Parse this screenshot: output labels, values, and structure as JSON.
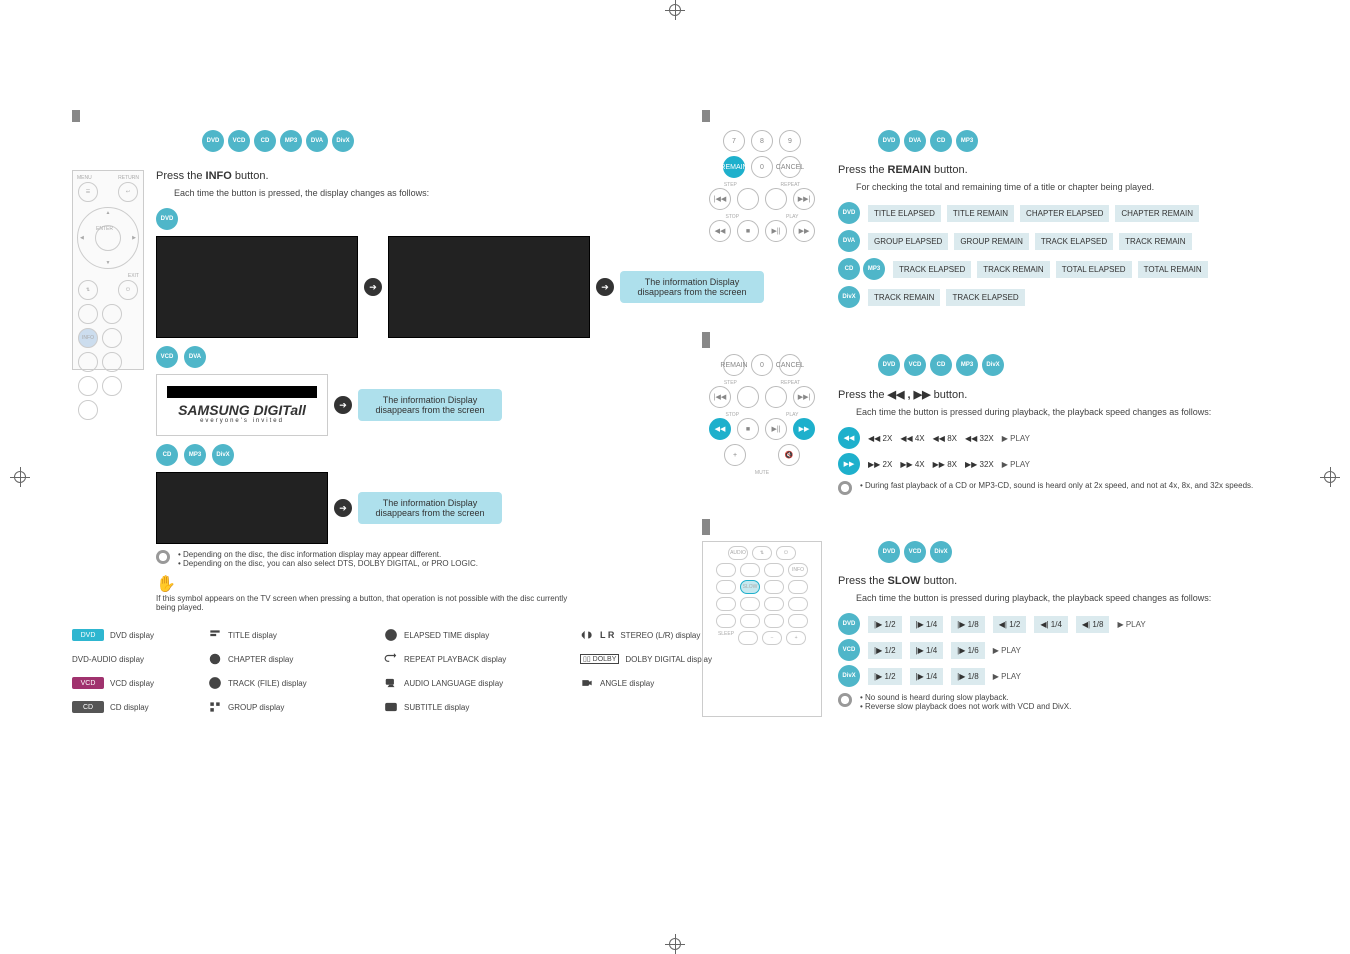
{
  "left": {
    "disc_row_count": 6,
    "press_info": "Press the",
    "button_word": "button.",
    "press_sub": "Each time the button is pressed, the display changes as follows:",
    "info_box": "The information Display disappears from the screen",
    "notes": [
      "• Depending on the disc, the disc information display may appear different.",
      "• Depending on the disc, you can also select DTS, DOLBY DIGITAL, or PRO LOGIC."
    ],
    "hand_text": "If this symbol appears on the TV screen when pressing a button, that operation is not possible with the disc currently being played.",
    "logo_main": "SAMSUNG DIGITall",
    "logo_sub": "everyone's invited",
    "legend": {
      "col1": [
        {
          "badge": "DVD",
          "cls": "b-dvd",
          "label": "DVD display"
        },
        {
          "badge": "",
          "cls": "",
          "label": "DVD-AUDIO display"
        },
        {
          "badge": "VCD",
          "cls": "b-vcd",
          "label": "VCD display"
        },
        {
          "badge": "CD",
          "cls": "b-cd",
          "label": "CD display"
        }
      ],
      "col2": [
        {
          "icon": "title",
          "label": "TITLE display"
        },
        {
          "icon": "chapter",
          "label": "CHAPTER display"
        },
        {
          "icon": "track",
          "label": "TRACK (FILE) display"
        },
        {
          "icon": "group",
          "label": "GROUP display"
        }
      ],
      "col3": [
        {
          "icon": "clock",
          "label": "ELAPSED TIME display"
        },
        {
          "icon": "repeat",
          "label": "REPEAT PLAYBACK display"
        },
        {
          "icon": "audio",
          "label": "AUDIO LANGUAGE display"
        },
        {
          "icon": "subtitle",
          "label": "SUBTITLE display"
        }
      ],
      "col4": [
        {
          "icon": "stereo",
          "label": "STEREO (L/R) display",
          "pre": "L R"
        },
        {
          "icon": "dolby",
          "label": "DOLBY DIGITAL display"
        },
        {
          "icon": "angle",
          "label": "ANGLE display"
        }
      ]
    },
    "remote": {
      "menu": "MENU",
      "return": "RETURN",
      "enter": "ENTER",
      "exit": "EXIT"
    }
  },
  "right": {
    "s1": {
      "discs": 4,
      "press": "Press the",
      "button": "button.",
      "sub": "For checking the total and remaining time of a title or chapter being played.",
      "rows": [
        {
          "badges": 1,
          "chips": [
            "TITLE ELAPSED",
            "TITLE REMAIN",
            "CHAPTER ELAPSED",
            "CHAPTER REMAIN"
          ]
        },
        {
          "badges": 1,
          "chips": [
            "GROUP ELAPSED",
            "GROUP REMAIN",
            "TRACK ELAPSED",
            "TRACK REMAIN"
          ]
        },
        {
          "badges": 2,
          "chips": [
            "TRACK ELAPSED",
            "TRACK REMAIN",
            "TOTAL ELAPSED",
            "TOTAL REMAIN"
          ]
        },
        {
          "badges": 1,
          "chips": [
            "TRACK REMAIN",
            "TRACK ELAPSED"
          ]
        }
      ],
      "keypad": {
        "seven": "7",
        "eight": "8",
        "nine": "9",
        "zero": "0",
        "remain": "REMAIN",
        "cancel": "CANCEL"
      }
    },
    "s2": {
      "discs": 5,
      "press": "Press the",
      "buttonglyph": "◀◀ , ▶▶",
      "button": "button.",
      "sub": "Each time the button is pressed during playback, the playback speed changes as follows:",
      "rows": [
        {
          "dir": "◀◀",
          "vals": [
            "2X",
            "4X",
            "8X",
            "32X"
          ],
          "end": "▶ PLAY"
        },
        {
          "dir": "▶▶",
          "vals": [
            "2X",
            "4X",
            "8X",
            "32X"
          ],
          "end": "▶ PLAY"
        }
      ],
      "note": "• During fast playback of a CD or MP3-CD, sound is heard only at 2x speed, and not at 4x, 8x, and 32x speeds."
    },
    "s3": {
      "discs": 3,
      "press": "Press the",
      "button": "button.",
      "sub": "Each time the button is pressed during playback, the playback speed changes as follows:",
      "rows": [
        {
          "vals": [
            "|▶ 1/2",
            "|▶ 1/4",
            "|▶ 1/8",
            "◀| 1/2",
            "◀| 1/4",
            "◀| 1/8"
          ],
          "end": "▶ PLAY"
        },
        {
          "vals": [
            "|▶ 1/2",
            "|▶ 1/4",
            "|▶ 1/6"
          ],
          "end": "▶ PLAY"
        },
        {
          "vals": [
            "|▶ 1/2",
            "|▶ 1/4",
            "|▶ 1/8"
          ],
          "end": "▶ PLAY"
        }
      ],
      "notes": [
        "• No sound is heard during slow playback.",
        "• Reverse slow playback does not work with VCD and DivX."
      ]
    }
  }
}
